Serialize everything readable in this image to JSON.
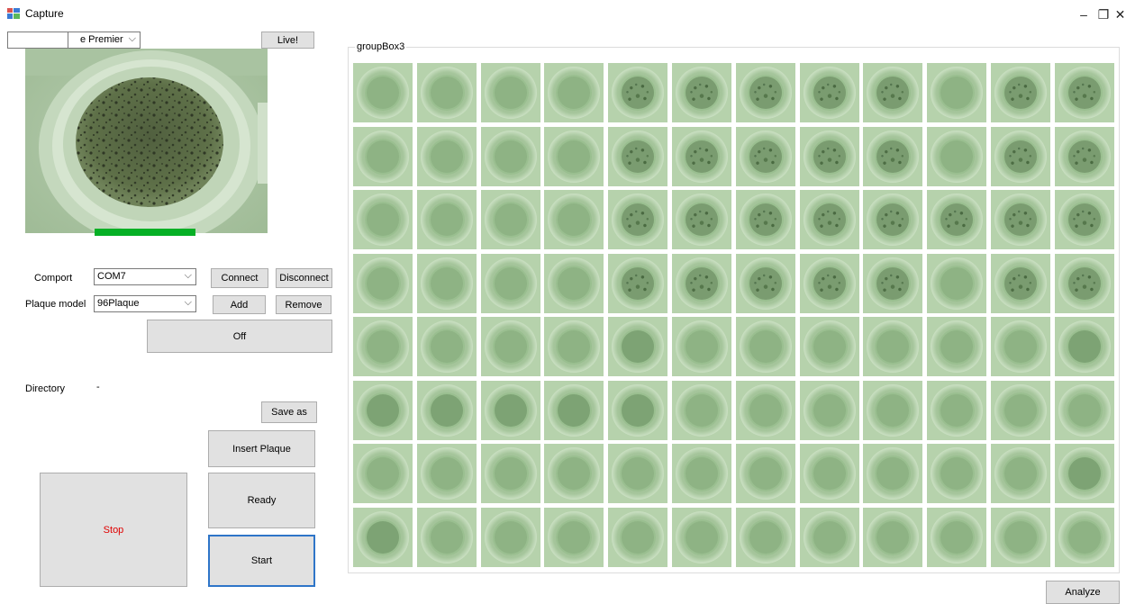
{
  "window": {
    "title": "Capture",
    "controls": [
      "–",
      "❐",
      "✕"
    ]
  },
  "camera": {
    "device_selected": "e Premier",
    "live_label": "Live!"
  },
  "progress": {
    "value": 1.0,
    "color": "#06b025"
  },
  "comport": {
    "label": "Comport",
    "value": "COM7",
    "connect_label": "Connect",
    "disconnect_label": "Disconnect"
  },
  "plaque_model": {
    "label": "Plaque model",
    "value": "96Plaque",
    "add_label": "Add",
    "remove_label": "Remove"
  },
  "off_label": "Off",
  "directory": {
    "label": "Directory",
    "value": "-"
  },
  "buttons": {
    "save_as": "Save as",
    "insert_plaque": "Insert Plaque",
    "ready": "Ready",
    "stop": "Stop",
    "start": "Start",
    "analyze": "Analyze"
  },
  "colors": {
    "stop_text": "#e00000",
    "focus_border": "#2e75c8"
  },
  "groupbox": {
    "label": "groupBox3",
    "rows": 8,
    "cols": 12,
    "spotted_wells": [
      [
        0,
        4
      ],
      [
        0,
        5
      ],
      [
        0,
        6
      ],
      [
        0,
        7
      ],
      [
        0,
        8
      ],
      [
        0,
        10
      ],
      [
        0,
        11
      ],
      [
        1,
        4
      ],
      [
        1,
        5
      ],
      [
        1,
        6
      ],
      [
        1,
        7
      ],
      [
        1,
        8
      ],
      [
        1,
        10
      ],
      [
        1,
        11
      ],
      [
        2,
        4
      ],
      [
        2,
        5
      ],
      [
        2,
        6
      ],
      [
        2,
        7
      ],
      [
        2,
        8
      ],
      [
        2,
        9
      ],
      [
        2,
        10
      ],
      [
        2,
        11
      ],
      [
        3,
        4
      ],
      [
        3,
        5
      ],
      [
        3,
        6
      ],
      [
        3,
        7
      ],
      [
        3,
        8
      ],
      [
        3,
        10
      ],
      [
        3,
        11
      ]
    ],
    "dark_wells": [
      [
        4,
        4
      ],
      [
        4,
        11
      ],
      [
        5,
        0
      ],
      [
        5,
        1
      ],
      [
        5,
        2
      ],
      [
        5,
        3
      ],
      [
        5,
        4
      ],
      [
        6,
        11
      ],
      [
        7,
        0
      ]
    ]
  }
}
